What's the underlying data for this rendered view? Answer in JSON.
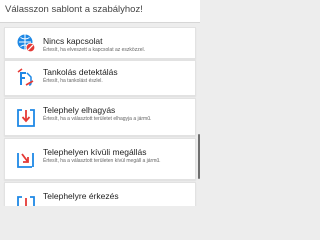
{
  "header": {
    "title": "Válasszon sablont a szabályhoz!"
  },
  "cards": [
    {
      "icon": "no-connection-icon",
      "title": "Nincs kapcsolat",
      "description": "Értesít, ha elveszett a kapcsolat az eszközzel."
    },
    {
      "icon": "fuel-pump-icon",
      "title": "Tankolás detektálás",
      "description": "Értesít, ha tankolást észlel."
    },
    {
      "icon": "area-exit-icon",
      "title": "Telephely elhagyás",
      "description": "Értesít, ha a választott területet elhagyja a jármű."
    },
    {
      "icon": "outside-area-stop-icon",
      "title": "Telephelyen kívüli megállás",
      "description": "Értesít, ha a választott területen kívül megáll a jármű."
    },
    {
      "icon": "area-arrival-icon",
      "title": "Telephelyre érkezés",
      "description": ""
    }
  ],
  "colors": {
    "primary_blue": "#1e88e5",
    "alert_red": "#e53935"
  }
}
